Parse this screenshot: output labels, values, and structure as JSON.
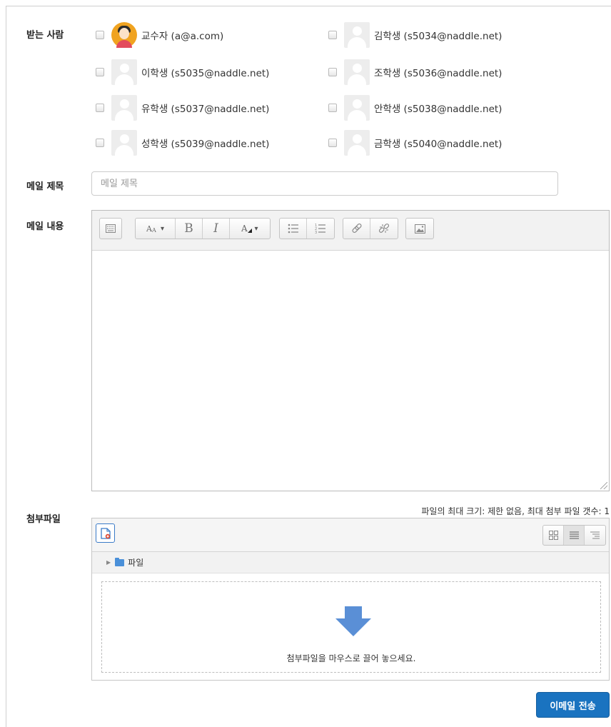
{
  "labels": {
    "recipients": "받는 사람",
    "subject": "메일 제목",
    "body": "메일 내용",
    "attachments": "첨부파일"
  },
  "recipients": [
    {
      "name": "교수자 (a@a.com)",
      "avatar": "teacher-photo"
    },
    {
      "name": "김학생 (s5034@naddle.net)",
      "avatar": "default-user"
    },
    {
      "name": "이학생 (s5035@naddle.net)",
      "avatar": "default-user"
    },
    {
      "name": "조학생 (s5036@naddle.net)",
      "avatar": "default-user"
    },
    {
      "name": "유학생 (s5037@naddle.net)",
      "avatar": "default-user"
    },
    {
      "name": "안학생 (s5038@naddle.net)",
      "avatar": "default-user"
    },
    {
      "name": "성학생 (s5039@naddle.net)",
      "avatar": "default-user"
    },
    {
      "name": "금학생 (s5040@naddle.net)",
      "avatar": "default-user"
    }
  ],
  "subject": {
    "placeholder": "메일 제목",
    "value": ""
  },
  "editor": {
    "toolbar_icons": [
      "toolbar-toggle-icon",
      "font-size-icon",
      "bold-icon",
      "italic-icon",
      "font-color-icon",
      "unordered-list-icon",
      "ordered-list-icon",
      "link-icon",
      "unlink-icon",
      "image-icon"
    ],
    "bold_glyph": "B",
    "italic_glyph": "I",
    "content": ""
  },
  "filepicker": {
    "limits": "파일의 최대 크기: 제한 없음, 최대 첨부 파일 갯수: 1",
    "folder": "파일",
    "drop_text": "첨부파일을 마우스로 끌어 놓으세요.",
    "view_icons": [
      "icon-view-icon",
      "list-view-icon",
      "tree-view-icon"
    ]
  },
  "send_button": "이메일 전송",
  "colors": {
    "accent": "#1a73c0",
    "arrow": "#5a8fd6"
  }
}
